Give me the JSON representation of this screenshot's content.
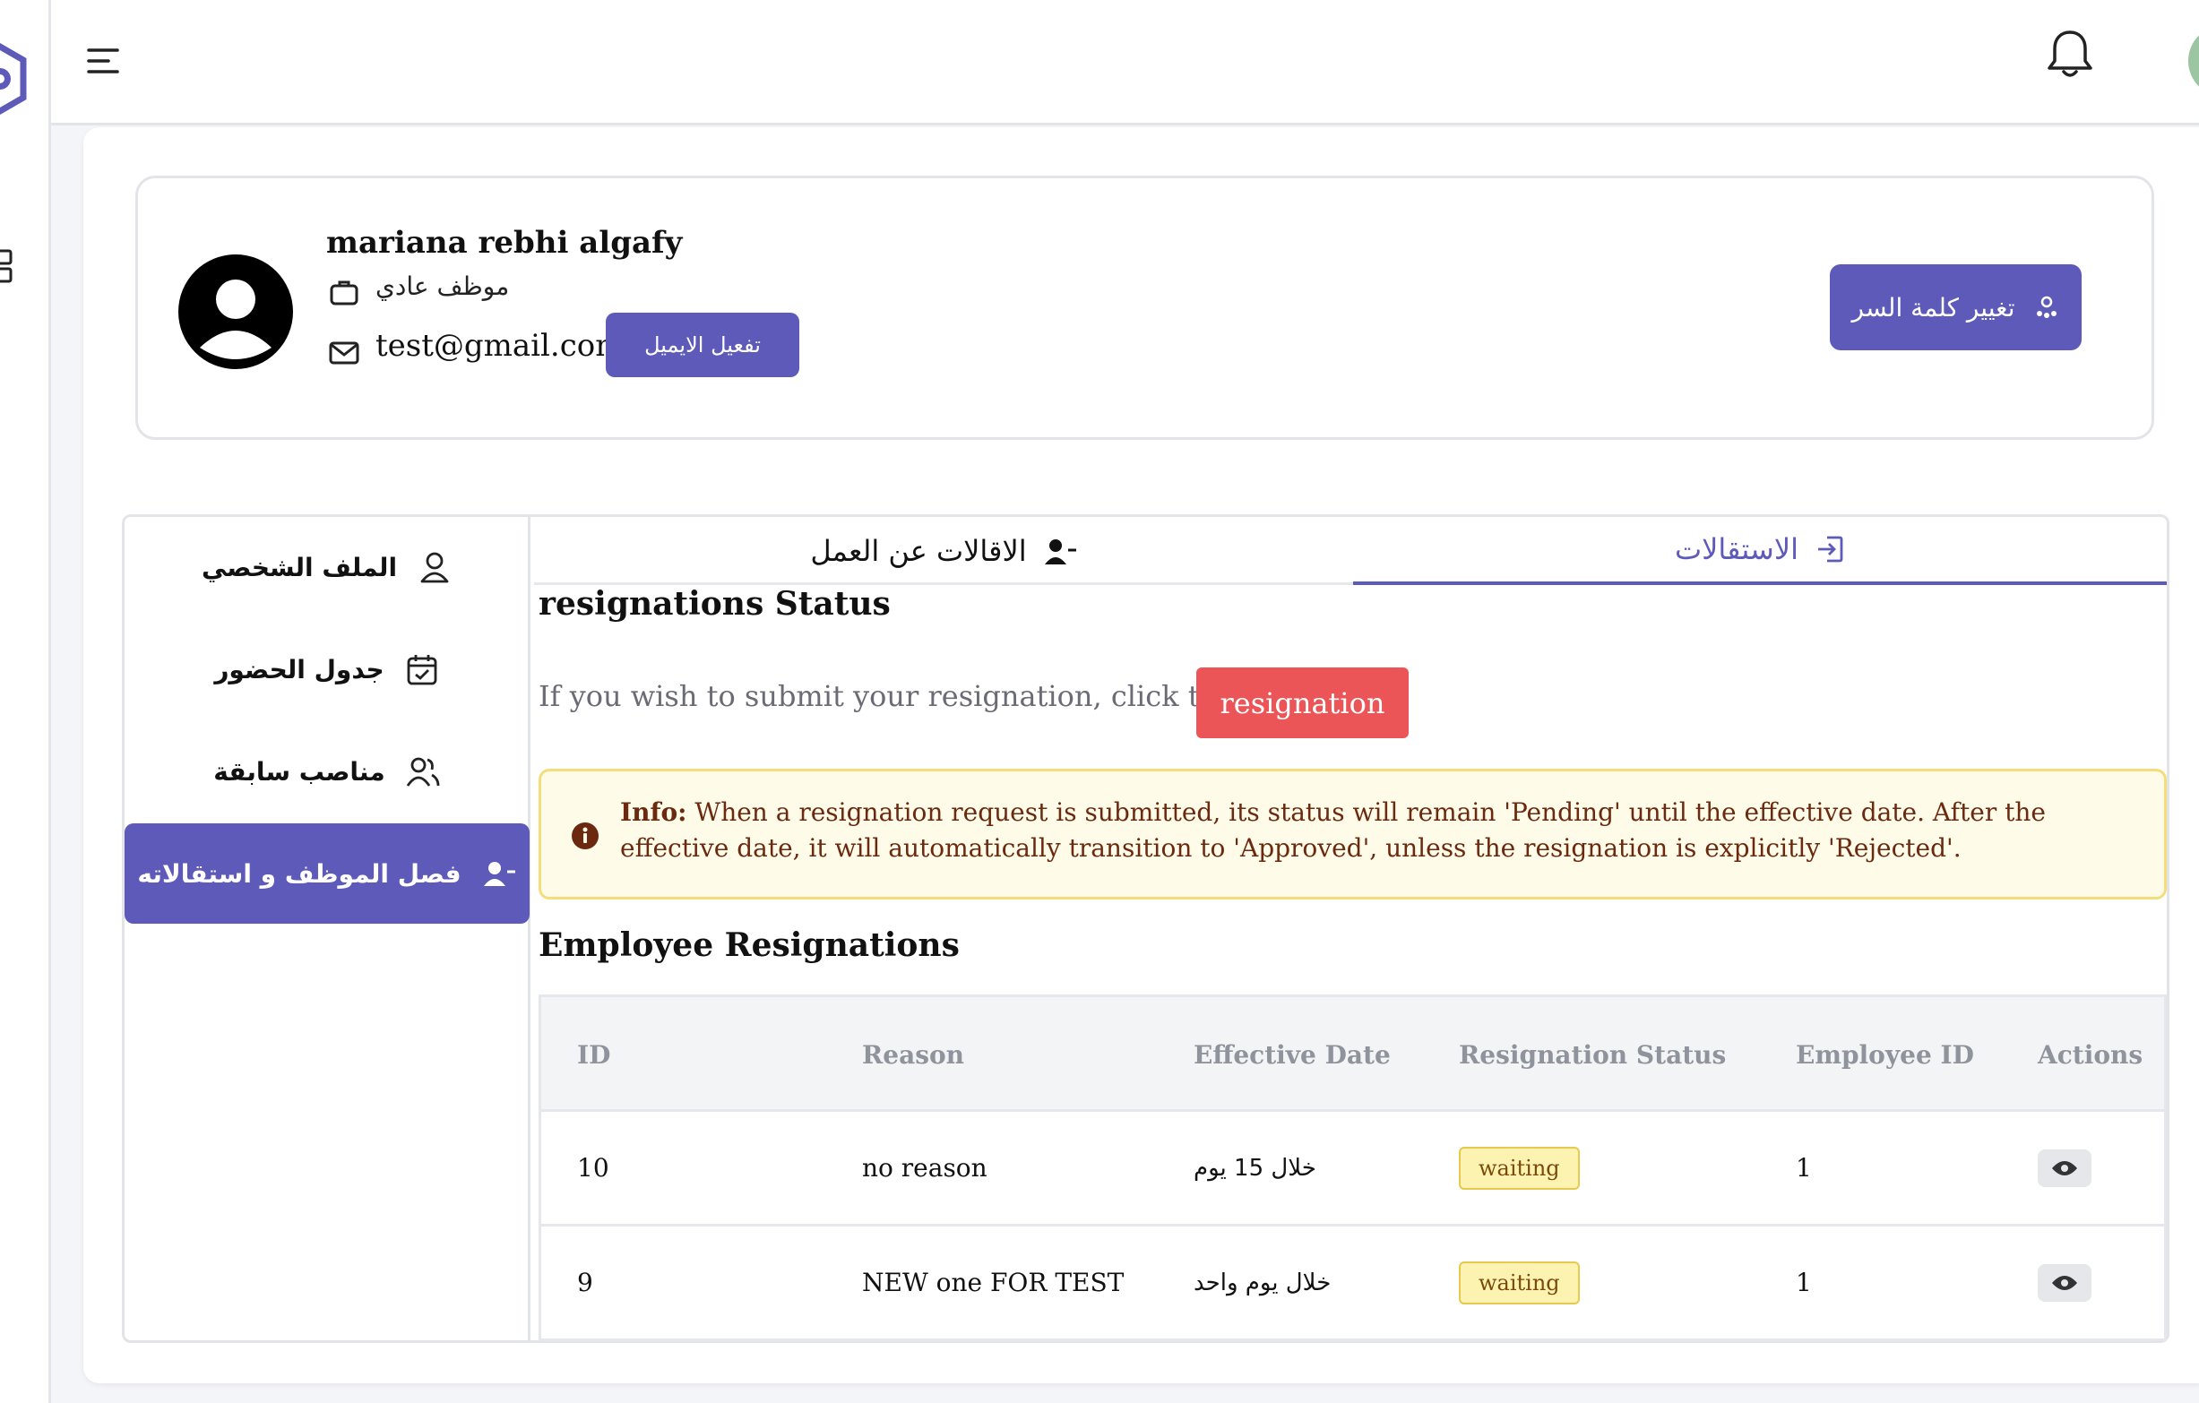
{
  "colors": {
    "accent": "#5e5ab9",
    "danger": "#ec5557",
    "info_bg": "#fefbe8",
    "info_border": "#f4dd7a",
    "badge_bg": "#fdf3b0"
  },
  "topbar": {
    "menu_icon": "menu-icon",
    "bell_icon": "bell-icon",
    "avatar_icon": "user-avatar"
  },
  "profile": {
    "name": "mariana rebhi algafy",
    "role": "موظف عادي",
    "email": "test@gmail.com",
    "activate_email_label": "تفعيل الايميل",
    "change_password_label": "تغيير كلمة السر"
  },
  "side_nav": {
    "items": [
      {
        "label": "الملف الشخصي",
        "icon": "user-icon"
      },
      {
        "label": "جدول الحضور",
        "icon": "calendar-check-icon"
      },
      {
        "label": "مناصب سابقة",
        "icon": "users-icon"
      },
      {
        "label": "فصل الموظف و استقالاته",
        "icon": "user-minus-icon"
      }
    ]
  },
  "tabs": {
    "dismissals": "الاقالات عن العمل",
    "resignations": "الاستقالات"
  },
  "resignation_status": {
    "title": "resignations Status",
    "submit_text": "If you wish to submit your resignation, click the",
    "button_label": "resignation"
  },
  "info": {
    "label": "Info:",
    "text": " When a resignation request is submitted, its status will remain 'Pending' until the effective date. After the effective date, it will automatically transition to 'Approved', unless the resignation is explicitly 'Rejected'."
  },
  "employee_resignations": {
    "title": "Employee Resignations",
    "columns": [
      "ID",
      "Reason",
      "Effective Date",
      "Resignation Status",
      "Employee ID",
      "Actions"
    ],
    "rows": [
      {
        "id": "10",
        "reason": "no reason",
        "effective_date": "خلال 15 يوم",
        "status": "waiting",
        "employee_id": "1"
      },
      {
        "id": "9",
        "reason": "NEW one FOR TEST",
        "effective_date": "خلال يوم واحد",
        "status": "waiting",
        "employee_id": "1"
      }
    ]
  }
}
